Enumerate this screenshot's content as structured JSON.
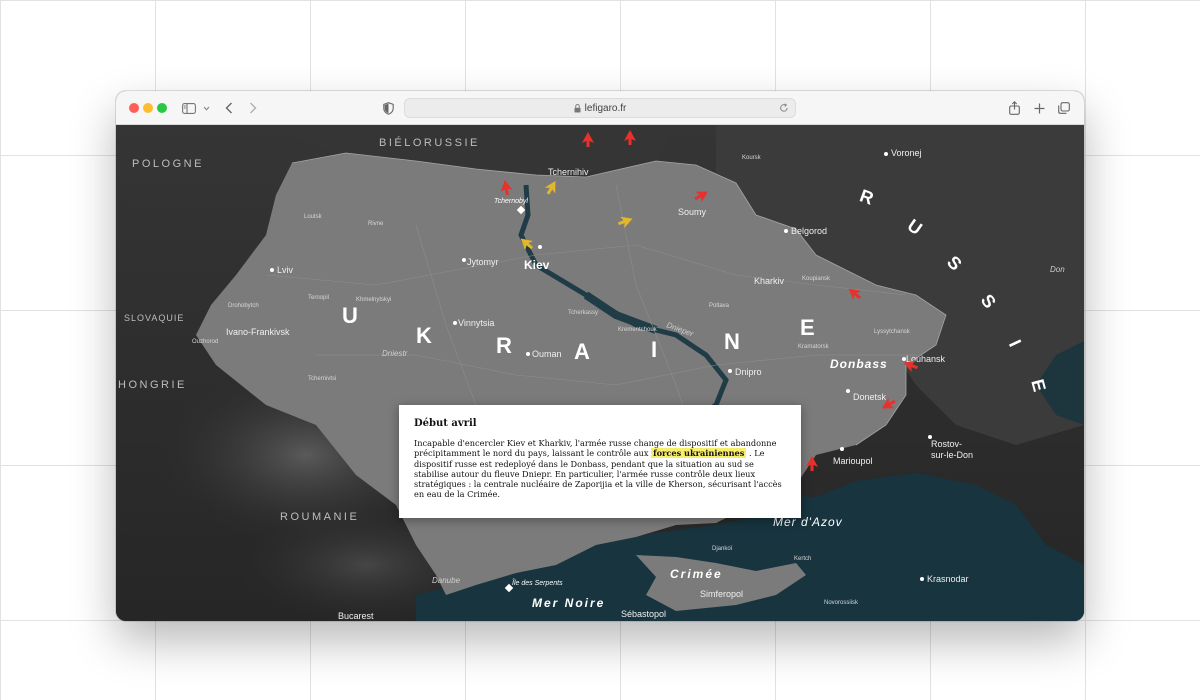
{
  "browser": {
    "url": "lefigaro.fr"
  },
  "info_box": {
    "title": "Début avril",
    "text_before": "Incapable d'encercler Kiev et Kharkiv, l'armée russe change de dispositif et abandonne précipitamment le nord du pays, laissant le contrôle aux ",
    "highlight": "forces ukrainiennes",
    "text_after": " . Le dispositif russe est redeployé dans le Donbass, pendant que la situation au sud se stabilise autour du fleuve Dniepr. En particulier, l'armée russe contrôle deux lieux stratégiques : la centrale nucléaire de Zaporijia et la ville de Kherson, sécurisant l'accès en eau de la Crimée."
  },
  "map": {
    "countries": [
      "POLOGNE",
      "BIÉLORUSSIE",
      "SLOVAQUIE",
      "HONGRIE",
      "ROUMANIE"
    ],
    "ukraine_letters": [
      "U",
      "K",
      "R",
      "A",
      "I",
      "N",
      "E"
    ],
    "russia_letters": [
      "R",
      "U",
      "S",
      "S",
      "I",
      "E"
    ],
    "cities_major": [
      "Kiev"
    ],
    "cities": [
      "Lviv",
      "Jytomyr",
      "Vinnytsia",
      "Ivano-Frankivsk",
      "Ouman",
      "Tchernihiv",
      "Soumy",
      "Kharkiv",
      "Dnipro",
      "Louhansk",
      "Donetsk",
      "Marioupol",
      "Voronej",
      "Belgorod",
      "Rostov-",
      "sur-le-Don",
      "Krasnodar",
      "Simferopol",
      "Sébastopol",
      "Bucarest"
    ],
    "towns": [
      "Loutsk",
      "Rivne",
      "Ternopil",
      "Khmelnytskyi",
      "Drohobytch",
      "Ouzhorod",
      "Tchernivtsi",
      "Tcherkassy",
      "Krementchouk",
      "Poltava",
      "Koupiansk",
      "Kramatorsk",
      "Lyssytchansk",
      "Koursk",
      "Kertch",
      "Djankoï",
      "Novorossiisk"
    ],
    "italic_labels": [
      "Tchernobyl",
      "Île des Serpents"
    ],
    "regions": [
      "Donbass"
    ],
    "seas": [
      "Mer d'Azov",
      "Mer Noire",
      "Crimée"
    ],
    "rivers": [
      "Dniestr",
      "Dnieper",
      "Danube",
      "Don"
    ],
    "colors": {
      "arrow_red": "#e8312c",
      "arrow_yellow": "#e2b72a",
      "ukraine_fill": "#7b7b7b",
      "sea": "#17343f"
    },
    "icons": {
      "share": "share-icon",
      "new_tab": "plus-icon",
      "tabs": "tab-overview-icon"
    }
  }
}
